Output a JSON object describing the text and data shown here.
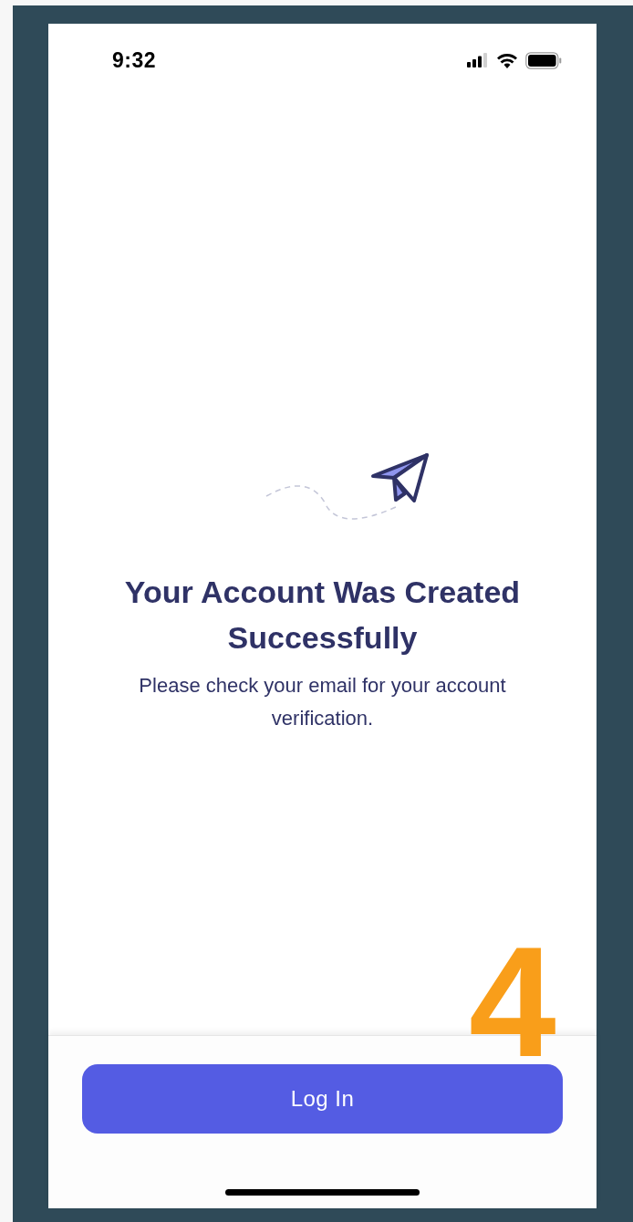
{
  "status_bar": {
    "time": "9:32"
  },
  "title": "Your Account Was Created Successfully",
  "message": "Please check your email for your account verification.",
  "buttons": [
    {
      "label": "Log In"
    }
  ],
  "step_number": "4"
}
